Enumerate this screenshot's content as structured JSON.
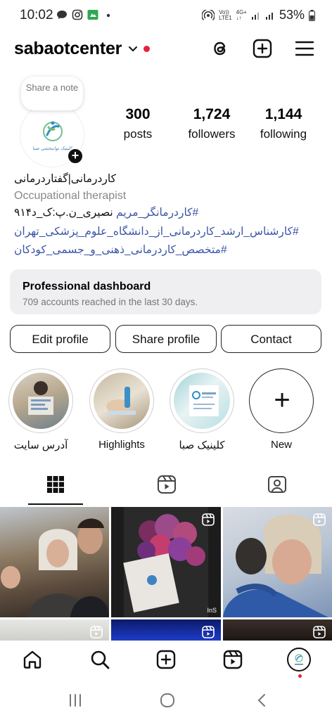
{
  "status_bar": {
    "time": "10:02",
    "network_top": "Vo))",
    "network_bottom": "LTE1",
    "gen_top": "4G+",
    "gen_bottom": "↓↑",
    "battery": "53%"
  },
  "header": {
    "username": "sabaotcenter"
  },
  "profile": {
    "note_label": "Share a note",
    "stats": {
      "posts_count": "300",
      "posts_label": "posts",
      "followers_count": "1,724",
      "followers_label": "followers",
      "following_count": "1,144",
      "following_label": "following"
    },
    "bio": {
      "name": "کاردرمانی|گفتاردرمانی",
      "category": "Occupational therapist",
      "line1_tag": "#کاردرمانگر_مریم",
      "line1_rest": " نصیری_ن.پ:ک_د۹۱۴",
      "line2": "#کارشناس_ارشد_کاردرمانی_از_دانشگاه_علوم_پزشکی_تهران",
      "line3": "#متخصص_کاردرمانی_ذهنی_و_جسمی_کودکان"
    },
    "dashboard": {
      "title": "Professional dashboard",
      "subtitle": "709 accounts reached in the last 30 days."
    },
    "buttons": {
      "edit": "Edit profile",
      "share": "Share profile",
      "contact": "Contact"
    }
  },
  "highlights": [
    {
      "label": "آدرس سایت"
    },
    {
      "label": "Highlights"
    },
    {
      "label": "کلینیک صبا"
    },
    {
      "label": "New"
    }
  ],
  "logo_text": "کلینیک توانبخشی صبا",
  "grid_post2_caption": "InS",
  "colors": {
    "link": "#3a55a8",
    "notification": "#e8203a",
    "dashboard_bg": "#efeff1"
  },
  "icons": {
    "header": [
      "chevron-down-icon",
      "threads-icon",
      "add-square-icon",
      "hamburger-menu-icon"
    ],
    "tabs": [
      "grid-icon",
      "reels-icon",
      "tagged-icon"
    ],
    "bottom_nav": [
      "home-icon",
      "search-icon",
      "add-icon",
      "reels-icon",
      "profile-avatar"
    ],
    "system_nav": [
      "recent-apps-icon",
      "home-circle-icon",
      "back-icon"
    ]
  }
}
